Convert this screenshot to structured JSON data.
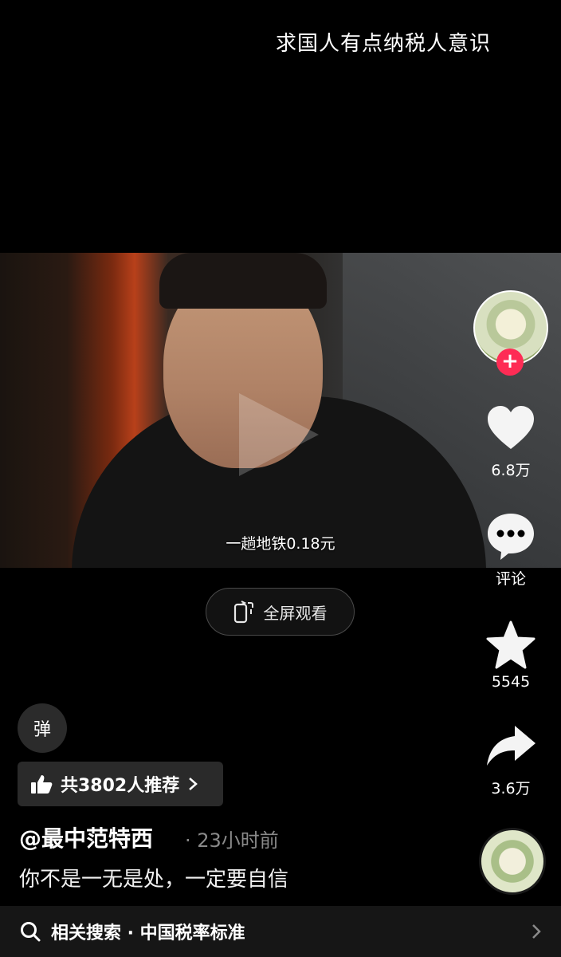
{
  "overlay": {
    "title": "求国人有点纳税人意识"
  },
  "video": {
    "subtitle": "一趟地铁0.18元"
  },
  "fullscreen": {
    "label": "全屏观看"
  },
  "rail": {
    "follow_plus": "+",
    "like_count": "6.8万",
    "comment_label": "评论",
    "favorite_count": "5545",
    "share_count": "3.6万"
  },
  "danmu": {
    "label": "弹"
  },
  "recommend": {
    "label": "共3802人推荐"
  },
  "post": {
    "author": "@最中范特西",
    "time": "· 23小时前",
    "caption": "你不是一无是处，一定要自信"
  },
  "search": {
    "label": "相关搜索 · 中国税率标准"
  },
  "colors": {
    "accent": "#fe2c55",
    "background": "#000000"
  }
}
